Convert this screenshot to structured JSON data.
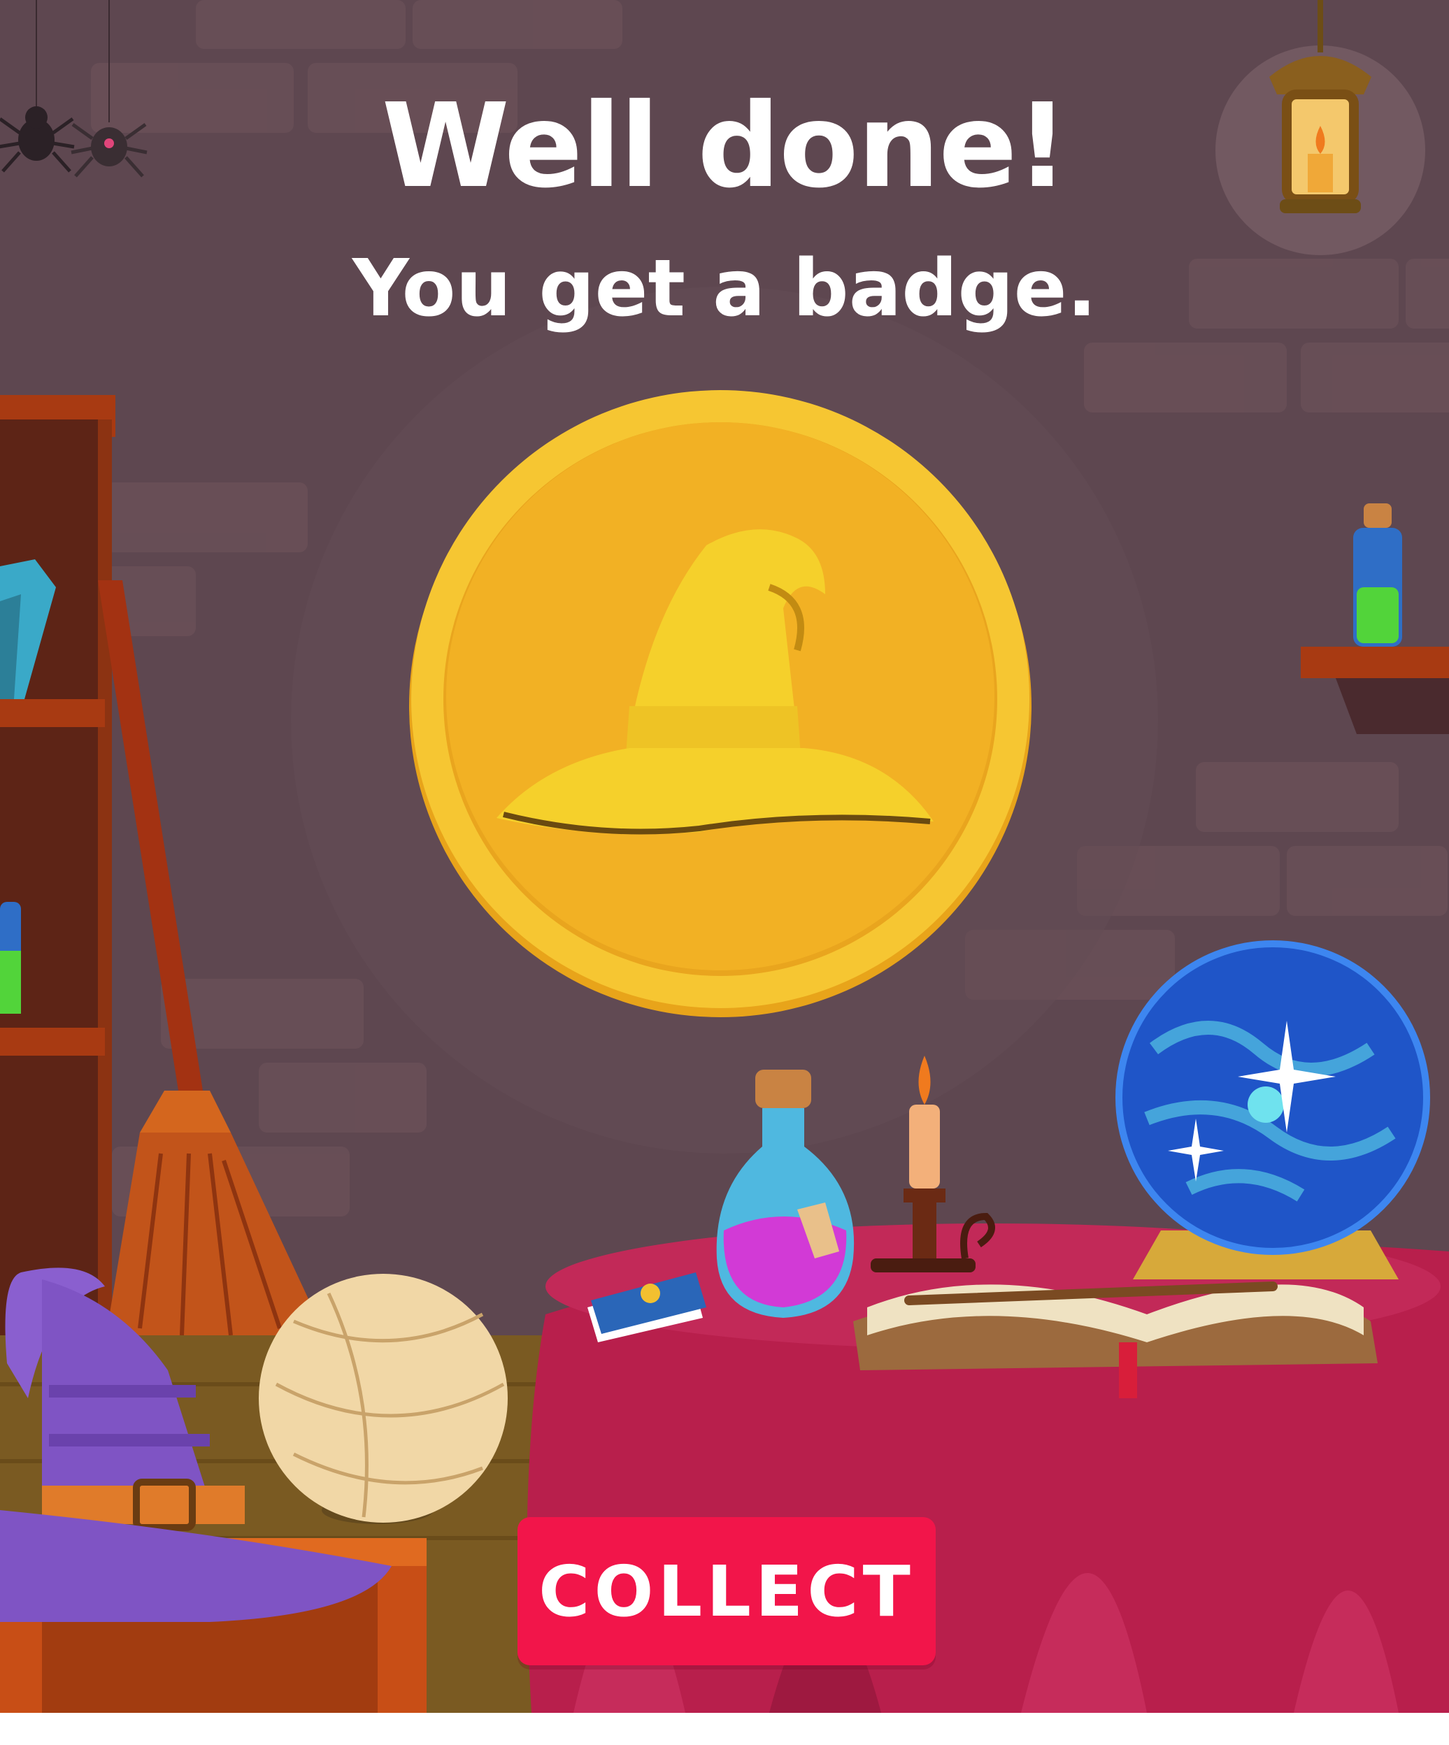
{
  "dialog": {
    "headline": "Well done!",
    "subline": "You get a badge.",
    "collect_label": "COLLECT"
  },
  "badge": {
    "icon": "wizard-hat-icon"
  },
  "colors": {
    "wall": "#5e4750",
    "brick": "#6a5058",
    "coin_outer": "#f6c632",
    "coin_inner": "#f2b124",
    "hat_on_coin": "#f5d02b",
    "button": "#f2154a",
    "tablecloth": "#b81f4c",
    "floor": "#7a5a22",
    "crystal_ball": "#1f55c8",
    "potion": "#d23ad6"
  }
}
